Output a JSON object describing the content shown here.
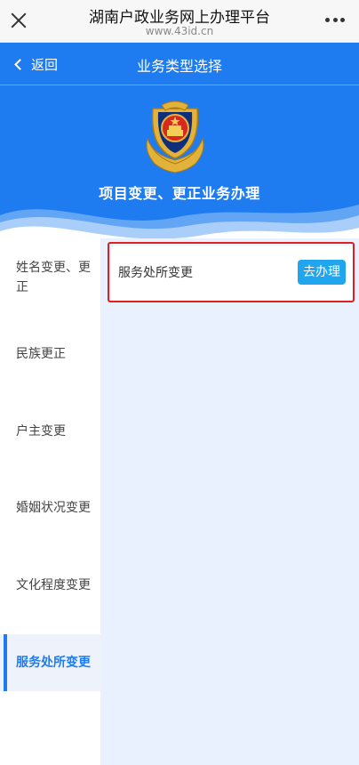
{
  "browser": {
    "title": "湖南户政业务网上办理平台",
    "url": "www.43id.cn"
  },
  "nav": {
    "back_label": "返回",
    "title": "业务类型选择"
  },
  "banner": {
    "title": "项目变更、更正业务办理"
  },
  "sidebar": {
    "items": [
      {
        "label": "姓名变更、更正"
      },
      {
        "label": "民族更正"
      },
      {
        "label": "户主变更"
      },
      {
        "label": "婚姻状况变更"
      },
      {
        "label": "文化程度变更"
      },
      {
        "label": "服务处所变更"
      }
    ],
    "active_index": 5
  },
  "content": {
    "items": [
      {
        "label": "服务处所变更",
        "button": "去办理"
      }
    ]
  },
  "colors": {
    "primary": "#1e7cf0",
    "button": "#1fa6ee",
    "highlight_border": "#e02020",
    "content_bg": "#e8f1fd"
  }
}
